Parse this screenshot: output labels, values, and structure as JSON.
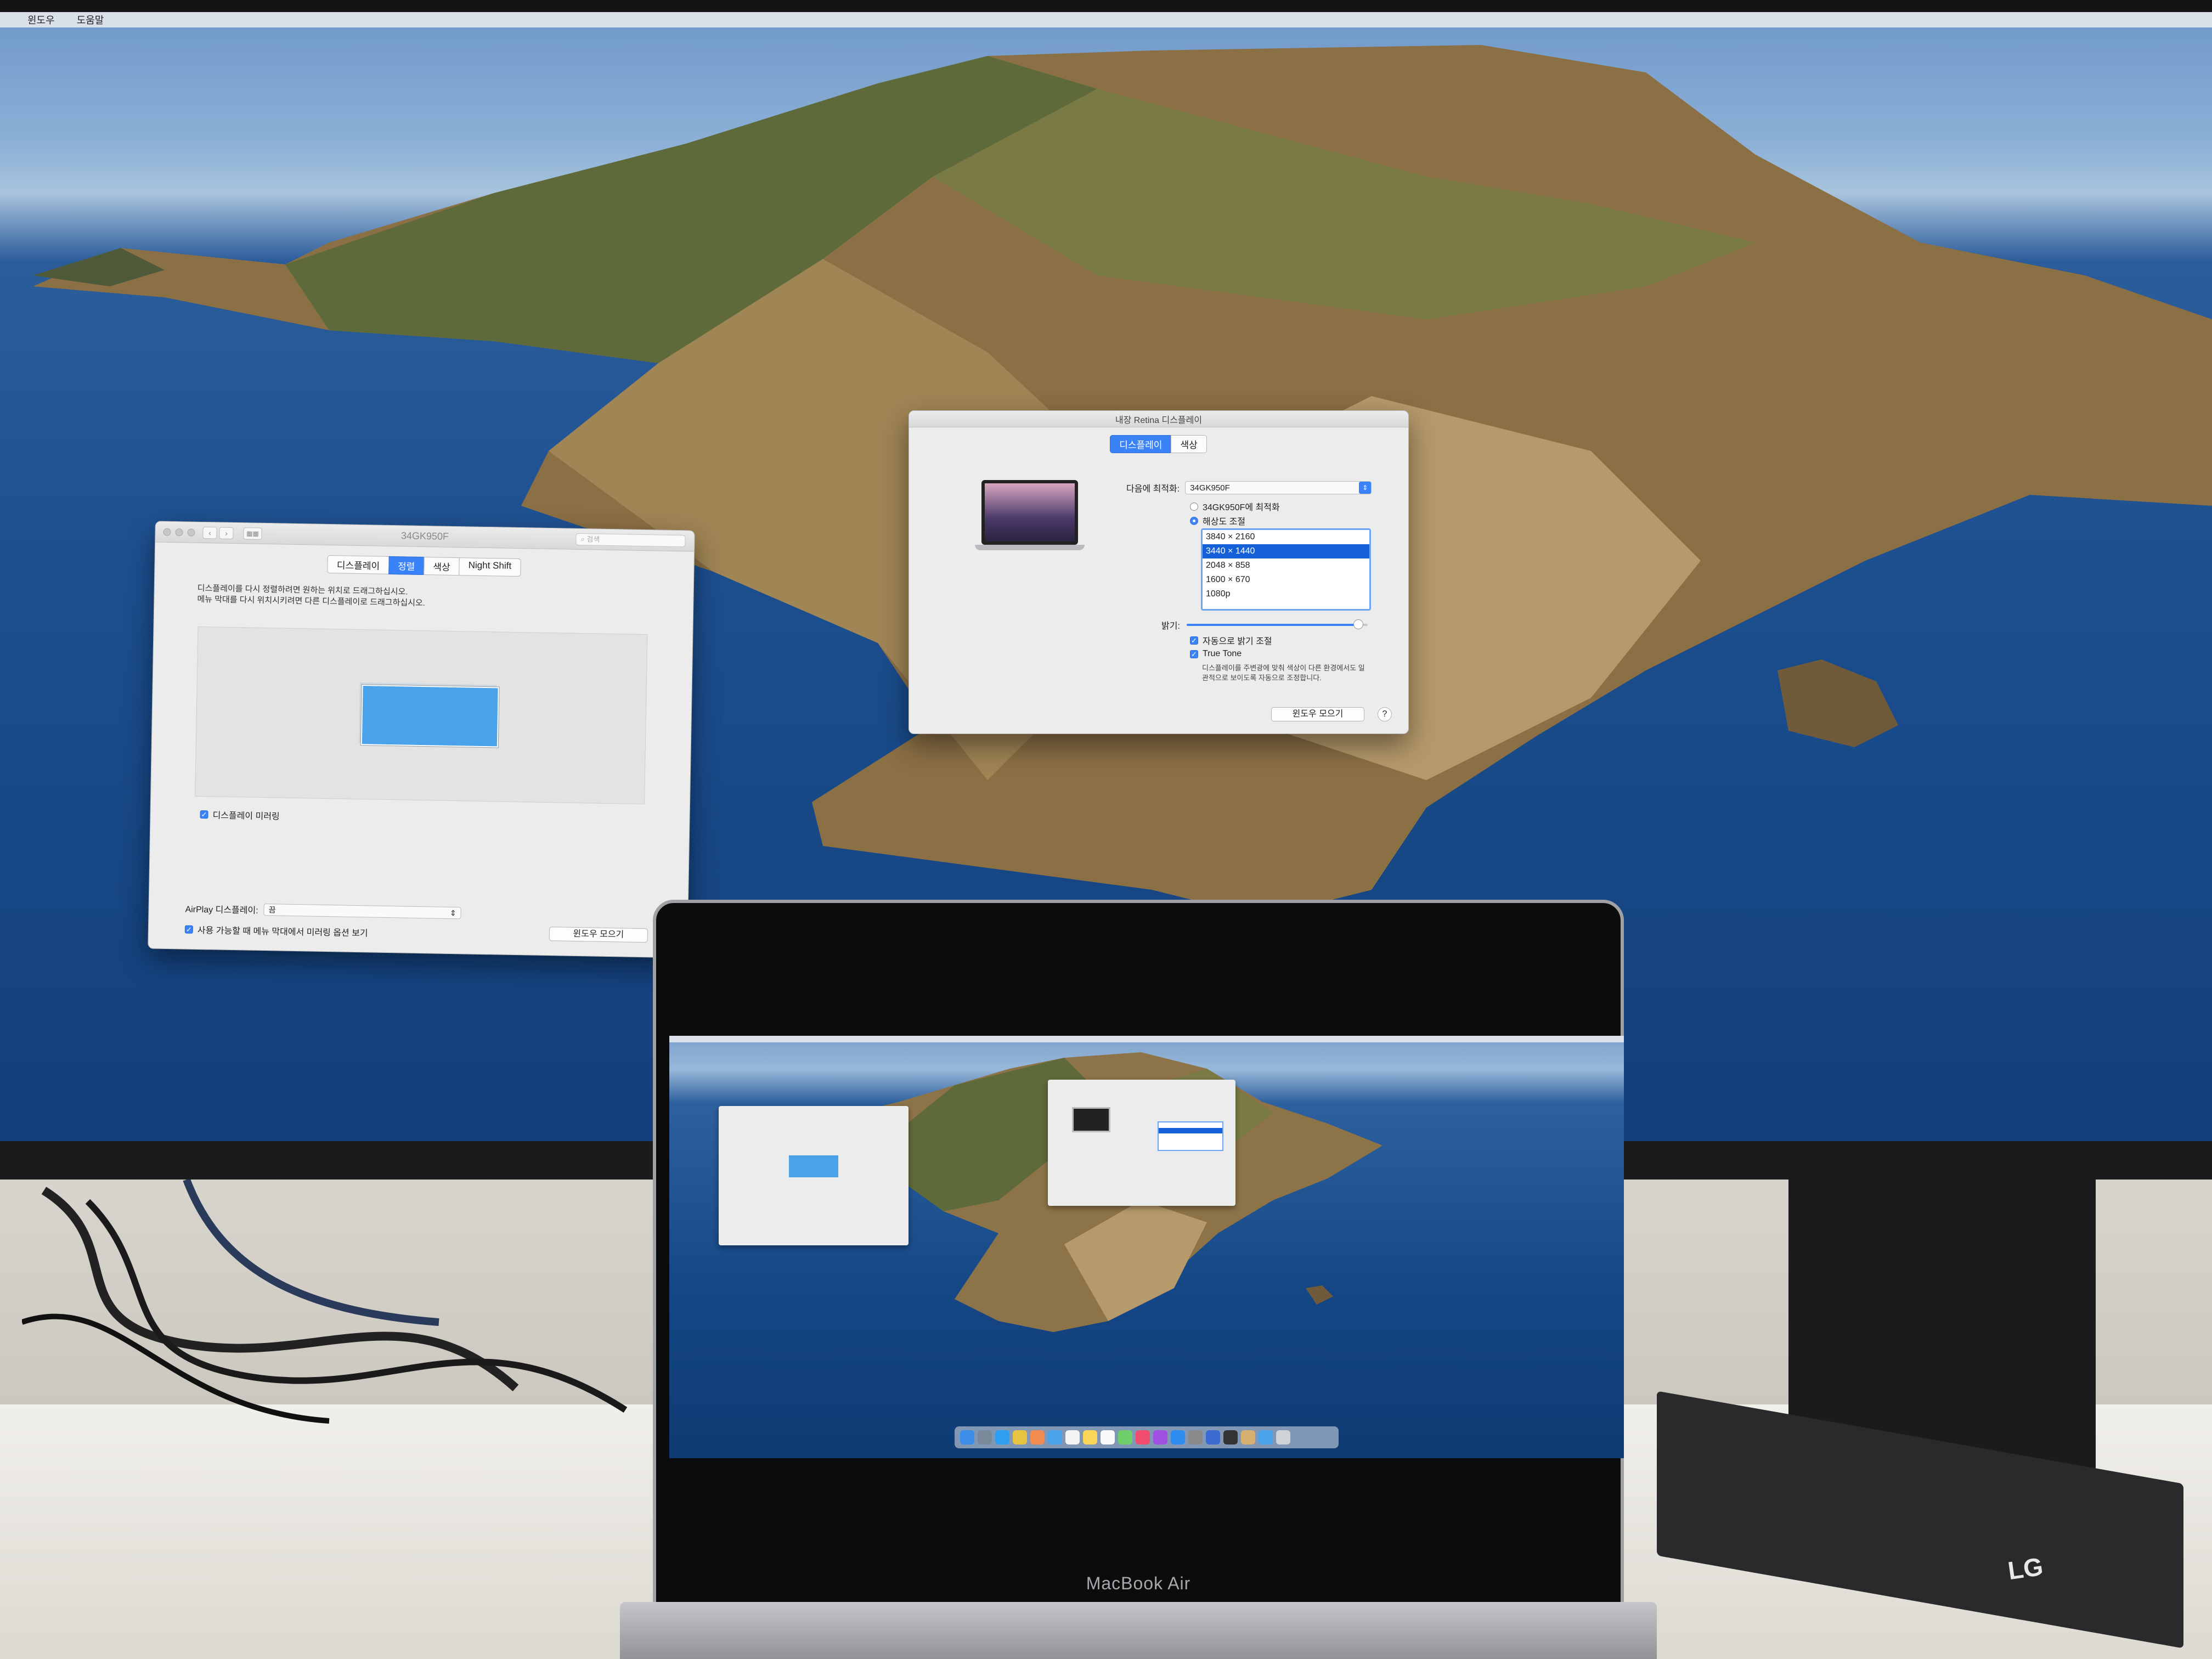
{
  "external_menubar": {
    "items": [
      "윈도우",
      "도움말"
    ]
  },
  "mirror_window": {
    "title": "34GK950F",
    "search_placeholder": "검색",
    "tabs": [
      "디스플레이",
      "정렬",
      "색상",
      "Night Shift"
    ],
    "active_tab_index": 1,
    "instructions_line1": "디스플레이를 다시 정렬하려면 원하는 위치로 드래그하십시오.",
    "instructions_line2": "메뉴 막대를 다시 위치시키려면 다른 디스플레이로 드래그하십시오.",
    "mirror_checkbox_label": "디스플레이 미러링",
    "mirror_checked": true,
    "airplay_label": "AirPlay 디스플레이:",
    "airplay_value": "끔",
    "menu_option_label": "사용 가능할 때 메뉴 막대에서 미러링 옵션 보기",
    "menu_option_checked": true,
    "gather_button": "윈도우 모으기"
  },
  "retina_window": {
    "title": "내장 Retina 디스플레이",
    "tabs": [
      "디스플레이",
      "색상"
    ],
    "active_tab_index": 0,
    "optimize_label": "다음에 최적화:",
    "optimize_value": "34GK950F",
    "radio_default": "34GK950F에 최적화",
    "radio_scaled": "해상도 조절",
    "resolutions": [
      "3840 × 2160",
      "3440 × 1440",
      "2048 × 858",
      "1600 × 670",
      "1080p"
    ],
    "selected_resolution_index": 1,
    "brightness_label": "밝기:",
    "brightness": 0.95,
    "auto_brightness_label": "자동으로 밝기 조절",
    "auto_brightness_checked": true,
    "true_tone_label": "True Tone",
    "true_tone_checked": true,
    "true_tone_desc_line1": "디스플레이를 주변광에 맞춰 색상이 다른 환경에서도 일",
    "true_tone_desc_line2": "관적으로 보이도록 자동으로 조정합니다.",
    "gather_button": "윈도우 모으기",
    "help_button": "?"
  },
  "macbook": {
    "label": "MacBook Air"
  },
  "monitor_brand": "LG",
  "colors": {
    "accent": "#3a82f7",
    "arrangement_display": "#4aa3ea",
    "window_bg": "#ececec"
  }
}
